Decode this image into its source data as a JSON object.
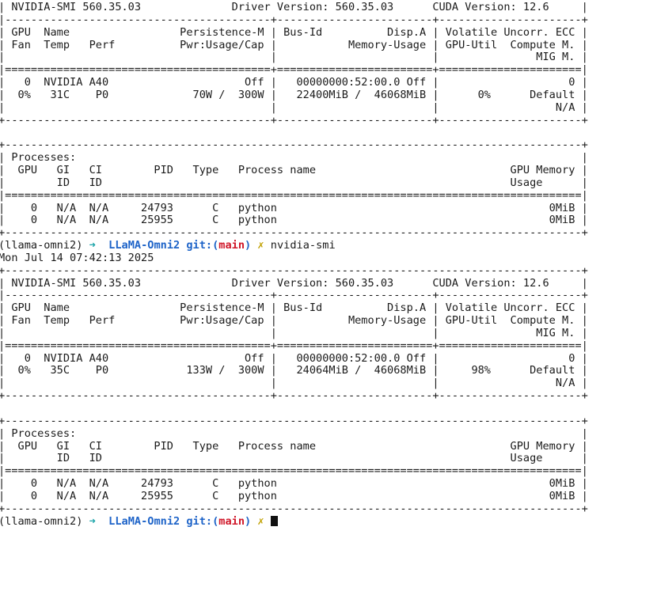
{
  "terminal": {
    "prompt_env": "(llama-omni2)",
    "prompt_arrow": "➜",
    "prompt_dir": "LLaMA-Omni2",
    "prompt_git": "git:(",
    "prompt_branch": "main",
    "prompt_git_close": ")",
    "prompt_dirty": "✗",
    "command": "nvidia-smi",
    "lines": [
      "+-----------------------------------------------------------------------------------------+",
      "| NVIDIA-SMI 560.35.03              Driver Version: 560.35.03      CUDA Version: 12.6     |",
      "|-----------------------------------------+------------------------+----------------------+",
      "| GPU  Name                 Persistence-M | Bus-Id          Disp.A | Volatile Uncorr. ECC |",
      "| Fan  Temp   Perf          Pwr:Usage/Cap |           Memory-Usage | GPU-Util  Compute M. |",
      "|                                         |                        |               MIG M. |",
      "|=========================================+========================+======================|",
      "|   0  NVIDIA A40                     Off |   00000000:52:00.0 Off |                    0 |",
      "|  0%   31C    P0             70W /  300W |   22400MiB /  46068MiB |      0%      Default |",
      "|                                         |                        |                  N/A |",
      "+-----------------------------------------+------------------------+----------------------+",
      "",
      "+-----------------------------------------------------------------------------------------+",
      "| Processes:                                                                              |",
      "|  GPU   GI   CI        PID   Type   Process name                              GPU Memory |",
      "|        ID   ID                                                               Usage      |",
      "|=========================================================================================|",
      "|    0   N/A  N/A     24793      C   python                                          0MiB |",
      "|    0   N/A  N/A     25955      C   python                                          0MiB |",
      "+-----------------------------------------------------------------------------------------+",
      "Mon Jul 14 07:42:13 2025",
      "+-----------------------------------------------------------------------------------------+",
      "| NVIDIA-SMI 560.35.03              Driver Version: 560.35.03      CUDA Version: 12.6     |",
      "|-----------------------------------------+------------------------+----------------------+",
      "| GPU  Name                 Persistence-M | Bus-Id          Disp.A | Volatile Uncorr. ECC |",
      "| Fan  Temp   Perf          Pwr:Usage/Cap |           Memory-Usage | GPU-Util  Compute M. |",
      "|                                         |                        |               MIG M. |",
      "|=========================================+========================+======================|",
      "|   0  NVIDIA A40                     Off |   00000000:52:00.0 Off |                    0 |",
      "|  0%   35C    P0            133W /  300W |   24064MiB /  46068MiB |     98%      Default |",
      "|                                         |                        |                  N/A |",
      "+-----------------------------------------+------------------------+----------------------+",
      "",
      "+-----------------------------------------------------------------------------------------+",
      "| Processes:                                                                              |",
      "|  GPU   GI   CI        PID   Type   Process name                              GPU Memory |",
      "|        ID   ID                                                               Usage      |",
      "|=========================================================================================|",
      "|    0   N/A  N/A     24793      C   python                                          0MiB |",
      "|    0   N/A  N/A     25955      C   python                                          0MiB |",
      "+-----------------------------------------------------------------------------------------+"
    ]
  },
  "colors": {
    "background": "#ffffff",
    "text": "#1b1b1b",
    "arrow": "#19a3a8",
    "repo": "#1d63c8",
    "branch": "#d0182a",
    "dirty": "#c0a000"
  }
}
